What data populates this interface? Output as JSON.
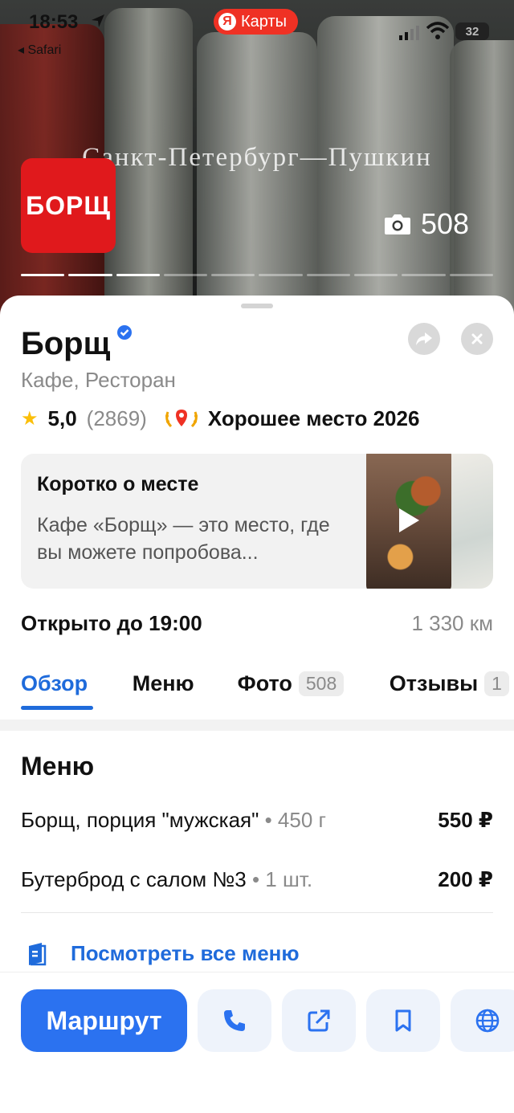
{
  "status_bar": {
    "time": "18:53",
    "back_app": "◂ Safari",
    "battery": "32",
    "app_pill": {
      "logo": "Я",
      "label": "Карты"
    }
  },
  "hero": {
    "caption": "Санкт-Петербург—Пушкин",
    "logo_text": "БОРЩ",
    "photo_count": "508",
    "gallery": {
      "pages_total": 10,
      "pages_highlighted": 3
    }
  },
  "place": {
    "name": "Борщ",
    "category": "Кафе, Ресторан",
    "rating": "5,0",
    "reviews_count": "(2869)",
    "award": "Хорошее место 2026"
  },
  "about": {
    "title": "Коротко о месте",
    "text": "Кафе «Борщ» — это место, где вы можете попробова..."
  },
  "info": {
    "hours": "Открыто до 19:00",
    "distance": "1 330 км"
  },
  "tabs": [
    {
      "label": "Обзор",
      "active": true
    },
    {
      "label": "Меню"
    },
    {
      "label": "Фото",
      "badge": "508"
    },
    {
      "label": "Отзывы",
      "badge": "1"
    }
  ],
  "menu": {
    "heading": "Меню",
    "items": [
      {
        "name": "Борщ, порция \"мужская\"",
        "meta": " • 450 г",
        "price": "550 ₽"
      },
      {
        "name": "Бутерброд с салом №3",
        "meta": " • 1 шт.",
        "price": "200 ₽"
      }
    ],
    "view_all": "Посмотреть все меню"
  },
  "actions": {
    "route": "Маршрут",
    "icons": [
      "phone-icon",
      "share-external-icon",
      "bookmark-icon",
      "globe-icon"
    ]
  },
  "colors": {
    "accent": "#2b72f0",
    "link": "#1f6bdb",
    "brand_red": "#e0191c",
    "star": "#fbbf0a",
    "ya_pill": "#ef3124"
  }
}
